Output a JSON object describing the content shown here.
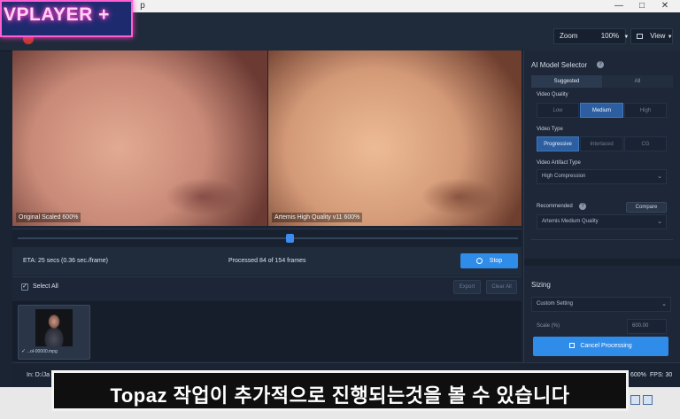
{
  "watermark": {
    "text": "VPLAYER +"
  },
  "window": {
    "title_fragment": "p"
  },
  "toolbar": {
    "zoom_label": "Zoom",
    "zoom_value": "100%",
    "view_label": "View"
  },
  "preview": {
    "left_label": "Original Scaled 600%",
    "right_label": "Artemis High Quality v11 600%"
  },
  "progress": {
    "eta_text": "ETA:  25 secs  (0.36 sec./frame)",
    "processed_text": "Processed 84 of 154 frames",
    "stop_label": "Stop"
  },
  "selection": {
    "select_all_label": "Select All",
    "export_label": "Export",
    "clear_label": "Clear All"
  },
  "files": [
    {
      "name": "...ol-00000.mpg"
    }
  ],
  "panel": {
    "title": "AI Model Selector",
    "tabs": [
      {
        "label": "Suggested",
        "active": true
      },
      {
        "label": "All",
        "active": false
      }
    ],
    "video_quality": {
      "label": "Video Quality",
      "options": [
        {
          "label": "Low",
          "active": false
        },
        {
          "label": "Medium",
          "active": true
        },
        {
          "label": "High",
          "active": false
        }
      ]
    },
    "video_type": {
      "label": "Video Type",
      "options": [
        {
          "label": "Progressive",
          "active": true
        },
        {
          "label": "Interlaced",
          "active": false
        },
        {
          "label": "CG",
          "active": false
        }
      ]
    },
    "artifact_type": {
      "label": "Video Artifact Type",
      "value": "High Compression"
    },
    "recommended": {
      "label": "Recommended",
      "compare_label": "Compare",
      "value": "Artemis Medium Quality"
    },
    "sizing": {
      "label": "Sizing",
      "value": "Custom Setting",
      "scale_label": "Scale (%)",
      "scale_value": "600.00"
    },
    "cancel_label": "Cancel Processing"
  },
  "statusbar": {
    "input_text": "In:  D:/Ja",
    "zoom_text": "600%",
    "fps_text": "FPS: 30"
  },
  "subtitle": {
    "text": "Topaz 작업이 추가적으로 진행되는것을 볼 수 있습니다"
  },
  "colors": {
    "accent": "#2f8ce8",
    "background": "#1b2433",
    "panel": "#1d2737"
  }
}
